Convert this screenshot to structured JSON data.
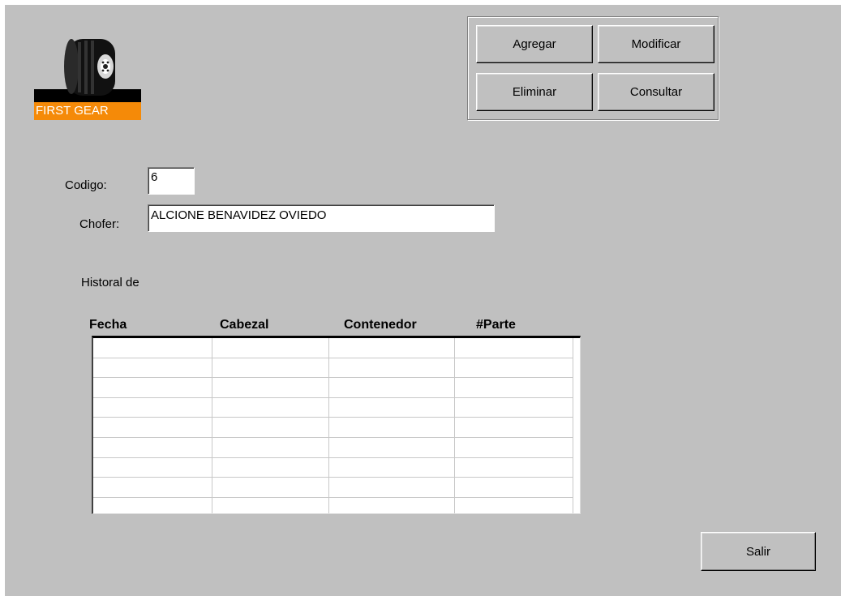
{
  "logo": {
    "text": "FIRST GEAR",
    "icon": "tire-icon",
    "accent": "#f58a08"
  },
  "actions": {
    "agregar": "Agregar",
    "modificar": "Modificar",
    "eliminar": "Eliminar",
    "consultar": "Consultar"
  },
  "fields": {
    "codigo_label": "Codigo:",
    "codigo_value": "6",
    "chofer_label": "Chofer:",
    "chofer_value": "ALCIONE BENAVIDEZ OVIEDO"
  },
  "history": {
    "title": "Historal de",
    "columns": [
      "Fecha",
      "Cabezal",
      "Contenedor",
      "#Parte"
    ],
    "rows": [
      [
        "",
        "",
        "",
        ""
      ],
      [
        "",
        "",
        "",
        ""
      ],
      [
        "",
        "",
        "",
        ""
      ],
      [
        "",
        "",
        "",
        ""
      ],
      [
        "",
        "",
        "",
        ""
      ],
      [
        "",
        "",
        "",
        ""
      ],
      [
        "",
        "",
        "",
        ""
      ],
      [
        "",
        "",
        "",
        ""
      ],
      [
        "",
        "",
        "",
        ""
      ]
    ]
  },
  "footer": {
    "salir": "Salir"
  },
  "colors": {
    "form_bg": "#c0c0c0",
    "logo_orange": "#f58a08"
  }
}
